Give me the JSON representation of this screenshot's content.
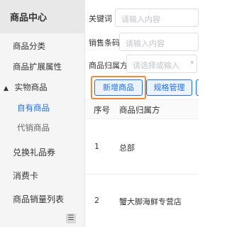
{
  "sidebar": {
    "header": "商品中心",
    "items": [
      {
        "label": "商品分类"
      },
      {
        "label": "商品扩展属性"
      },
      {
        "label": "实物商品",
        "expanded_icon": "▲"
      },
      {
        "label": "自有商品"
      },
      {
        "label": "代销商品"
      },
      {
        "label": "兑换礼品券"
      },
      {
        "label": "消费卡"
      },
      {
        "label": "商品销量列表"
      }
    ],
    "collapse_icon": "☰"
  },
  "filters": {
    "keyword_label": "关键词",
    "keyword_placeholder": "请输入内容",
    "barcode_label": "销售条码",
    "barcode_placeholder": "请输入内容",
    "owner_label": "商品归属方",
    "owner_placeholder": "请选择或输入"
  },
  "toolbar": {
    "add_label": "新增商品",
    "spec_label": "规格管理"
  },
  "table": {
    "headers": [
      "序号",
      "商品归属方"
    ],
    "rows": [
      [
        "1",
        "总部"
      ],
      [
        "2",
        "蟹大脚海鲜专营店"
      ]
    ]
  }
}
